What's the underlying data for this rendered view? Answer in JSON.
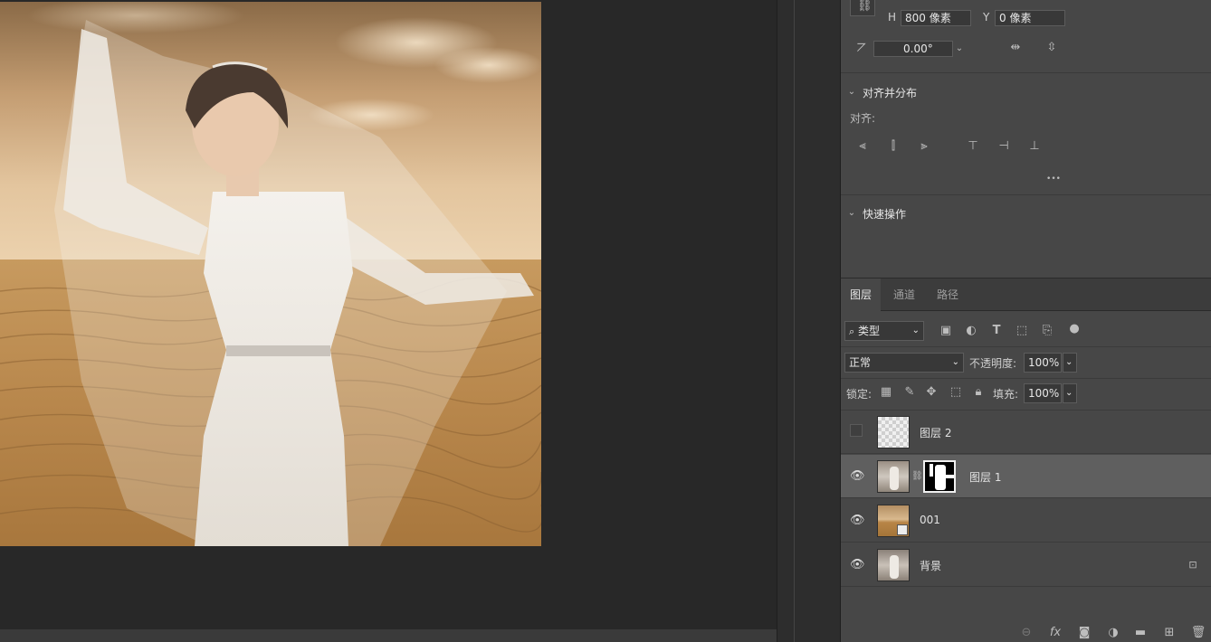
{
  "transform": {
    "h_label": "H",
    "h_value": "800 像素",
    "y_label": "Y",
    "y_value": "0 像素",
    "angle_value": "0.00°"
  },
  "align": {
    "title": "对齐并分布",
    "subtitle": "对齐:",
    "more": "•••"
  },
  "quick_actions": {
    "title": "快速操作"
  },
  "layers_panel": {
    "tabs": [
      "图层",
      "通道",
      "路径"
    ],
    "filter_label": "类型",
    "blend_mode": "正常",
    "opacity_label": "不透明度:",
    "opacity_value": "100%",
    "lock_label": "锁定:",
    "fill_label": "填充:",
    "fill_value": "100%",
    "layers": [
      {
        "name": "图层 2",
        "visible": false
      },
      {
        "name": "图层 1",
        "visible": true,
        "selected": true
      },
      {
        "name": "001",
        "visible": true
      },
      {
        "name": "背景",
        "visible": true,
        "locked": true
      }
    ]
  },
  "icons": {
    "eye": "eye-icon",
    "lock": "lock-icon",
    "link": "link-icon",
    "fx": "fx"
  },
  "colors": {
    "panel_bg": "#474747",
    "selected_row": "#5f5f5f",
    "canvas_bg": "#282828"
  }
}
